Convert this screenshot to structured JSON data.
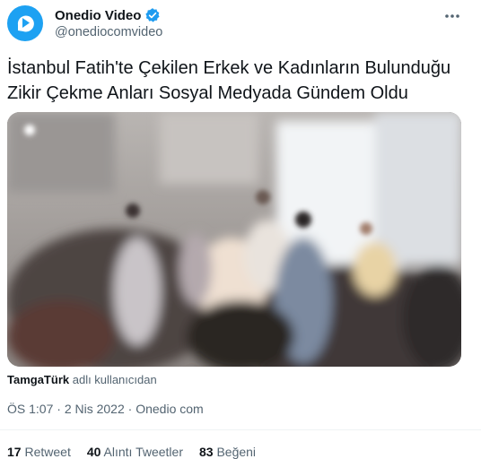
{
  "author": {
    "display_name": "Onedio Video",
    "handle": "@onediocomvideo"
  },
  "tweet": {
    "text": "İstanbul Fatih'te Çekilen Erkek ve Kadınların Bulunduğu Zikir Çekme Anları Sosyal Medyada Gündem Oldu"
  },
  "media": {
    "owner": "TamgaTürk",
    "suffix": "adlı kullanıcıdan"
  },
  "meta": {
    "time": "ÖS 1:07",
    "date": "2 Nis 2022",
    "source": "Onedio com",
    "separator": "·"
  },
  "stats": [
    {
      "count": "17",
      "label": "Retweet"
    },
    {
      "count": "40",
      "label": "Alıntı Tweetler"
    },
    {
      "count": "83",
      "label": "Beğeni"
    }
  ],
  "colors": {
    "accent": "#1da1f2",
    "verified": "#1d9bf0",
    "secondary_text": "#536471"
  },
  "icons": {
    "avatar": "play-icon",
    "verified": "verified-badge-icon",
    "more": "more-icon"
  }
}
